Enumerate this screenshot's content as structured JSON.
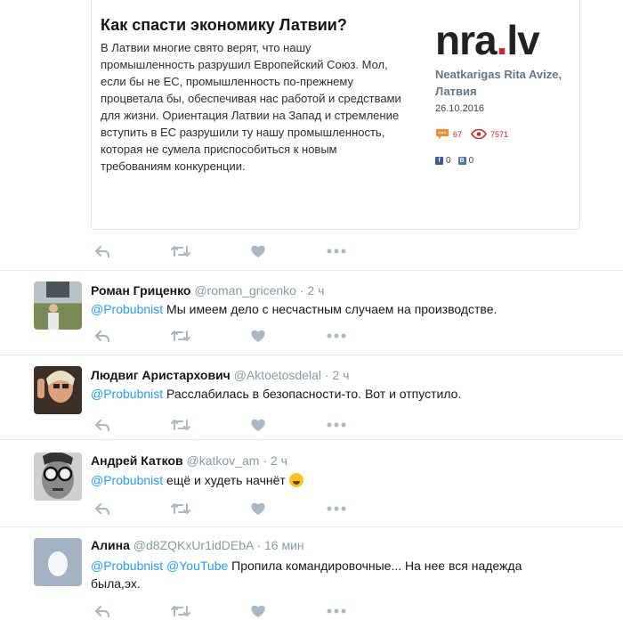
{
  "card": {
    "title": "Как спасти экономику Латвии?",
    "body": "В Латвии многие свято верят, что нашу промышленность разрушил Европейский Союз. Мол, если бы не ЕС, промышленность по-прежнему процветала бы, обеспечивая нас работой и средствами для жизни. Ориентация Латвии на Запад и стремление вступить в ЕС разрушили ту нашу промышленность, которая не сумела приспособиться к новым требованиям конкуренции.",
    "logo_main": "nra",
    "logo_dot": ".",
    "logo_tld": "lv",
    "source": "Neatkarigas Rita Avize, Латвия",
    "date": "26.10.2016",
    "comments": "67",
    "views": "7571",
    "fb_count": "0",
    "vk_count": "0"
  },
  "replies": [
    {
      "name": "Роман Гриценко",
      "handle": "@roman_gricenko",
      "time": "· 2 ч",
      "mentions": "@Probubnist",
      "text": " Мы имеем дело с несчастным случаем на производстве."
    },
    {
      "name": "Людвиг Аристархович",
      "handle": "@Aktoetosdelal",
      "time": "· 2 ч",
      "mentions": "@Probubnist",
      "text": " Расслабилась в безопасности-то. Вот и отпустило."
    },
    {
      "name": "Андрей Катков",
      "handle": "@katkov_am",
      "time": "· 2 ч",
      "mentions": "@Probubnist",
      "text": " ещё и худеть начнёт "
    },
    {
      "name": "Алина",
      "handle": "@d8ZQKxUr1idDEbA",
      "time": "· 16 мин",
      "mentions": "@Probubnist @YouTube",
      "text": " Пропила командировочные... На нее вся надежда была,эх."
    }
  ],
  "colors": {
    "accent": "#1da1f2",
    "icon": "#aab8c2",
    "logo_red": "#d2232a"
  },
  "icons": [
    "reply-icon",
    "retweet-icon",
    "like-icon",
    "more-icon",
    "comment-icon",
    "eye-icon",
    "facebook-icon",
    "vk-icon"
  ]
}
